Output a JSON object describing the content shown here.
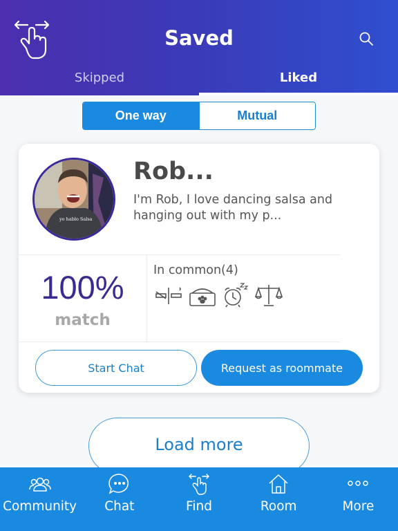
{
  "header": {
    "title": "Saved",
    "tabs": [
      {
        "label": "Skipped",
        "active": false
      },
      {
        "label": "Liked",
        "active": true
      }
    ]
  },
  "segment": {
    "options": [
      {
        "label": "One way",
        "active": true
      },
      {
        "label": "Mutual",
        "active": false
      }
    ]
  },
  "card": {
    "name": "Rob...",
    "bio": "I'm Rob, I love dancing salsa and hanging out with my p...",
    "shirt_text": "yo hablo Salsa",
    "match_percent": "100%",
    "match_label": "match",
    "in_common_label": "In common(4)",
    "in_common_icons": [
      "no-smoking-icon",
      "pet-bed-icon",
      "alarm-clock-sleep-icon",
      "scales-icon"
    ],
    "start_chat_label": "Start Chat",
    "request_label": "Request as roommate"
  },
  "load_more_label": "Load more",
  "bottom_nav": [
    {
      "label": "Community",
      "icon": "community-icon"
    },
    {
      "label": "Chat",
      "icon": "chat-icon"
    },
    {
      "label": "Find",
      "icon": "find-swipe-icon"
    },
    {
      "label": "Room",
      "icon": "room-icon"
    },
    {
      "label": "More",
      "icon": "more-icon"
    }
  ],
  "colors": {
    "header_start": "#4b2fae",
    "header_end": "#2f4fd0",
    "accent_blue": "#1a8ae0",
    "match_purple": "#3b2a8f"
  }
}
